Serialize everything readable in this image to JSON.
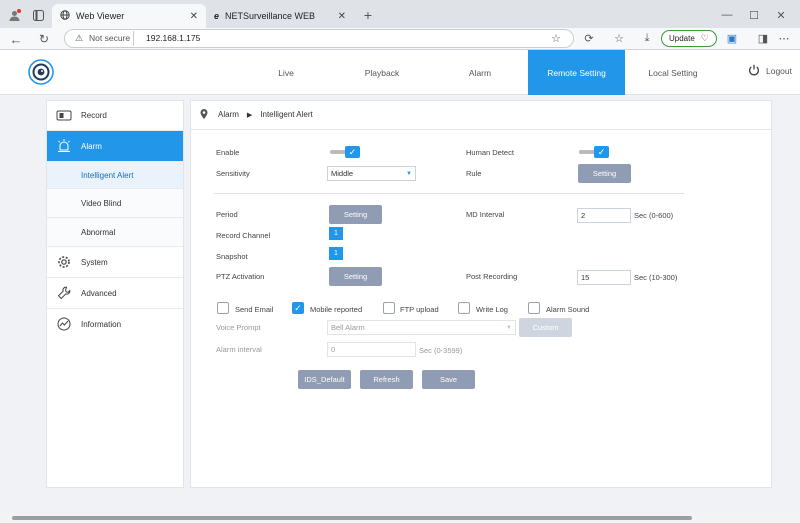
{
  "browser": {
    "tabs": [
      {
        "label": "Web Viewer"
      },
      {
        "label": "NETSurveillance WEB"
      }
    ],
    "address": {
      "security_label": "Not secure",
      "url": "192.168.1.175"
    },
    "update_label": "Update"
  },
  "nav": {
    "items": [
      {
        "label": "Live"
      },
      {
        "label": "Playback"
      },
      {
        "label": "Alarm"
      },
      {
        "label": "Remote Setting"
      },
      {
        "label": "Local Setting"
      }
    ],
    "logout_label": "Logout"
  },
  "sidebar": {
    "items": [
      {
        "label": "Record"
      },
      {
        "label": "Alarm"
      },
      {
        "label": "Intelligent Alert"
      },
      {
        "label": "Video Blind"
      },
      {
        "label": "Abnormal"
      },
      {
        "label": "System"
      },
      {
        "label": "Advanced"
      },
      {
        "label": "Information"
      }
    ]
  },
  "breadcrumb": {
    "section": "Alarm",
    "page": "Intelligent Alert"
  },
  "form": {
    "enable_label": "Enable",
    "human_detect_label": "Human Detect",
    "sensitivity_label": "Sensitivity",
    "sensitivity_value": "Middle",
    "rule_label": "Rule",
    "rule_button": "Setting",
    "period_label": "Period",
    "period_button": "Setting",
    "md_interval_label": "MD Interval",
    "md_interval_value": "2",
    "md_interval_unit": "Sec (0-600)",
    "record_channel_label": "Record Channel",
    "record_channel_value": "1",
    "snapshot_label": "Snapshot",
    "snapshot_value": "1",
    "ptz_label": "PTZ Activation",
    "ptz_button": "Setting",
    "post_recording_label": "Post Recording",
    "post_recording_value": "15",
    "post_recording_unit": "Sec (10-300)",
    "checkboxes": [
      {
        "label": "Send Email",
        "checked": false
      },
      {
        "label": "Mobile reported",
        "checked": true
      },
      {
        "label": "FTP upload",
        "checked": false
      },
      {
        "label": "Write Log",
        "checked": false
      },
      {
        "label": "Alarm Sound",
        "checked": false
      }
    ],
    "voice_prompt_label": "Voice Prompt",
    "voice_prompt_value": "Bell Alarm",
    "custom_button": "Custom",
    "alarm_interval_label": "Alarm interval",
    "alarm_interval_value": "0",
    "alarm_interval_unit": "Sec (0-3599)"
  },
  "actions": {
    "default": "IDS_Default",
    "refresh": "Refresh",
    "save": "Save"
  },
  "colors": {
    "accent": "#2296e8",
    "button": "#8f9cb3"
  }
}
